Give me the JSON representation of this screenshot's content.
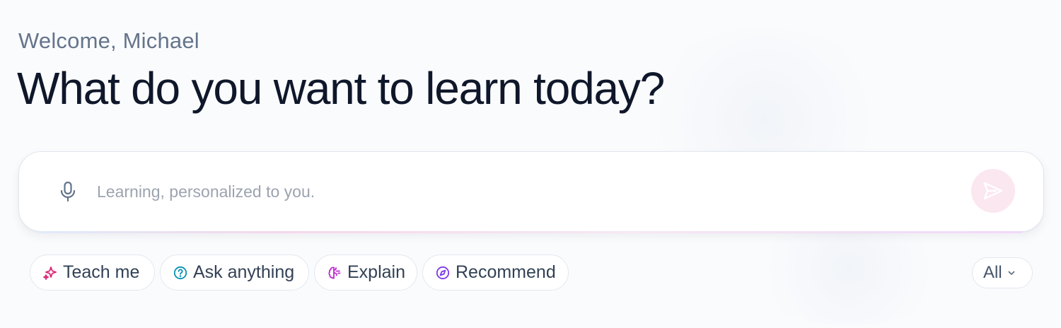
{
  "header": {
    "welcome": "Welcome, Michael",
    "headline": "What do you want to learn today?"
  },
  "prompt": {
    "placeholder": "Learning, personalized to you.",
    "value": "",
    "mic_icon": "microphone-icon",
    "send_icon": "send-icon"
  },
  "chips": [
    {
      "label": "Teach me",
      "icon": "sparkles-icon",
      "color": "#db2777"
    },
    {
      "label": "Ask anything",
      "icon": "question-circle-icon",
      "color": "#0891b2"
    },
    {
      "label": "Explain",
      "icon": "brain-icon",
      "color": "#c026d3"
    },
    {
      "label": "Recommend",
      "icon": "compass-icon",
      "color": "#7c3aed"
    }
  ],
  "filter": {
    "selected": "All",
    "icon": "chevron-down-icon"
  },
  "colors": {
    "headline": "#0f172a",
    "welcome": "#64748b",
    "send_button_bg": "#fbe7ef"
  }
}
